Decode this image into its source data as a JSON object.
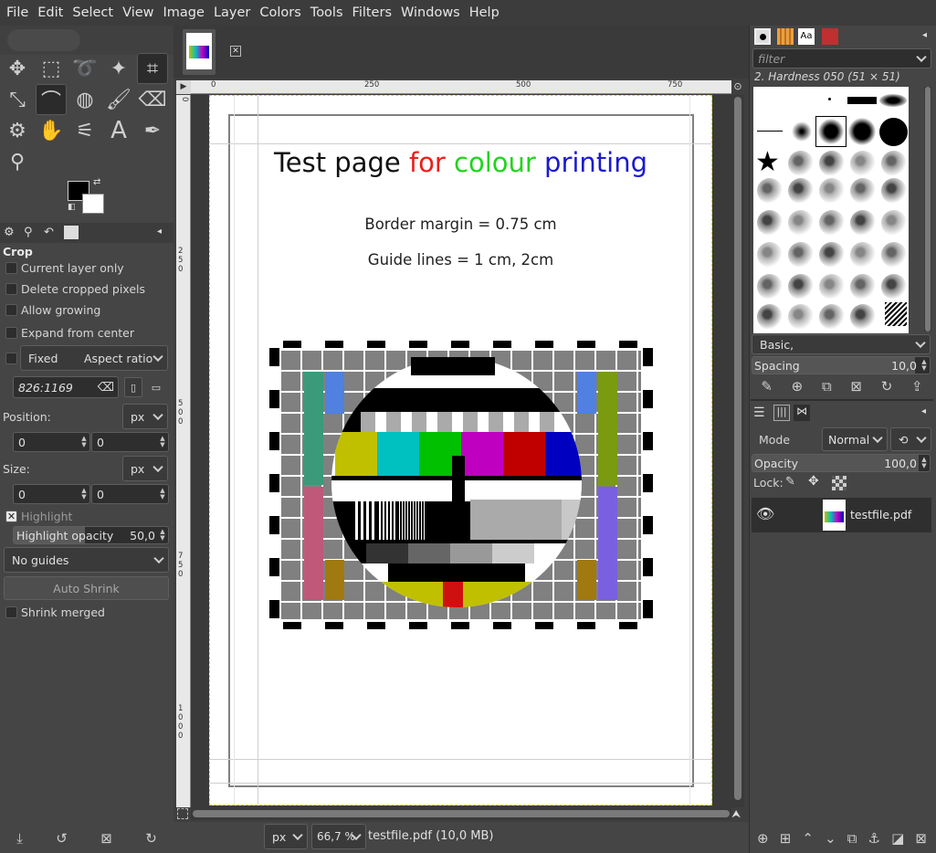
{
  "menubar": {
    "items": [
      "File",
      "Edit",
      "Select",
      "View",
      "Image",
      "Layer",
      "Colors",
      "Tools",
      "Filters",
      "Windows",
      "Help"
    ]
  },
  "toolbox": {
    "tools": [
      "move-tool-icon",
      "rect-select-icon",
      "lasso-icon",
      "fuzzy-select-icon",
      "crop-icon",
      "transform-icon",
      "warp-icon",
      "bucket-fill-icon",
      "paintbrush-icon",
      "eraser-icon",
      "clone-icon",
      "smudge-icon",
      "paths-icon",
      "text-tool-icon",
      "color-picker-icon",
      "zoom-icon"
    ],
    "text_tool_glyph": "A",
    "fg_color": "#000000",
    "bg_color": "#ffffff"
  },
  "tool_options": {
    "title": "Crop",
    "current_layer_only": "Current layer only",
    "delete_cropped": "Delete cropped pixels",
    "allow_growing": "Allow growing",
    "expand_from_center": "Expand from center",
    "fixed_label": "Fixed",
    "aspect_label": "Aspect ratio",
    "ratio_value": "826:1169",
    "position_label": "Position:",
    "position_unit": "px",
    "pos_x": "0",
    "pos_y": "0",
    "size_label": "Size:",
    "size_unit": "px",
    "size_w": "0",
    "size_h": "0",
    "highlight_label": "Highlight",
    "highlight_opacity_label": "Highlight opacity",
    "highlight_opacity_value": "50,0",
    "guides_value": "No guides",
    "auto_shrink": "Auto Shrink",
    "shrink_merged": "Shrink merged"
  },
  "ruler": {
    "top": [
      "0",
      "250",
      "500",
      "750"
    ],
    "left": [
      "0",
      "250",
      "500",
      "750",
      "1000"
    ]
  },
  "document": {
    "title_black": "Test page ",
    "title_red": "for ",
    "title_green": "colour ",
    "title_blue": "printing",
    "line1": "Border margin = 0.75 cm",
    "line2": "Guide lines = 1 cm, 2cm",
    "colors": {
      "red": "#e8201c",
      "green": "#22d41e",
      "blue": "#1a1ad2"
    }
  },
  "testcard": {
    "bars": [
      "#c0c000",
      "#00c0c0",
      "#00c000",
      "#c000c0",
      "#c00000",
      "#0000c0"
    ],
    "grays": [
      "#000000",
      "#333333",
      "#666666",
      "#999999",
      "#cccccc",
      "#ffffff"
    ],
    "side_left": [
      "#3a9a7a",
      "#c0587a",
      "#a07a10"
    ],
    "side_right": [
      "#7a9a10",
      "#7a60e0",
      "#a07a10"
    ],
    "top_blue": "#5080e0"
  },
  "statusbar": {
    "unit": "px",
    "zoom": "66,7 %",
    "file_info": "testfile.pdf (10,0 MB)"
  },
  "brushes": {
    "filter_placeholder": "filter",
    "selected_name": "2. Hardness 050 (51 × 51)",
    "preset": "Basic,",
    "spacing_label": "Spacing",
    "spacing_value": "10,0",
    "tab_aa": "Aa"
  },
  "layers": {
    "mode_label": "Mode",
    "mode_value": "Normal",
    "opacity_label": "Opacity",
    "opacity_value": "100,0",
    "lock_label": "Lock:",
    "layer_name": "testfile.pdf"
  }
}
